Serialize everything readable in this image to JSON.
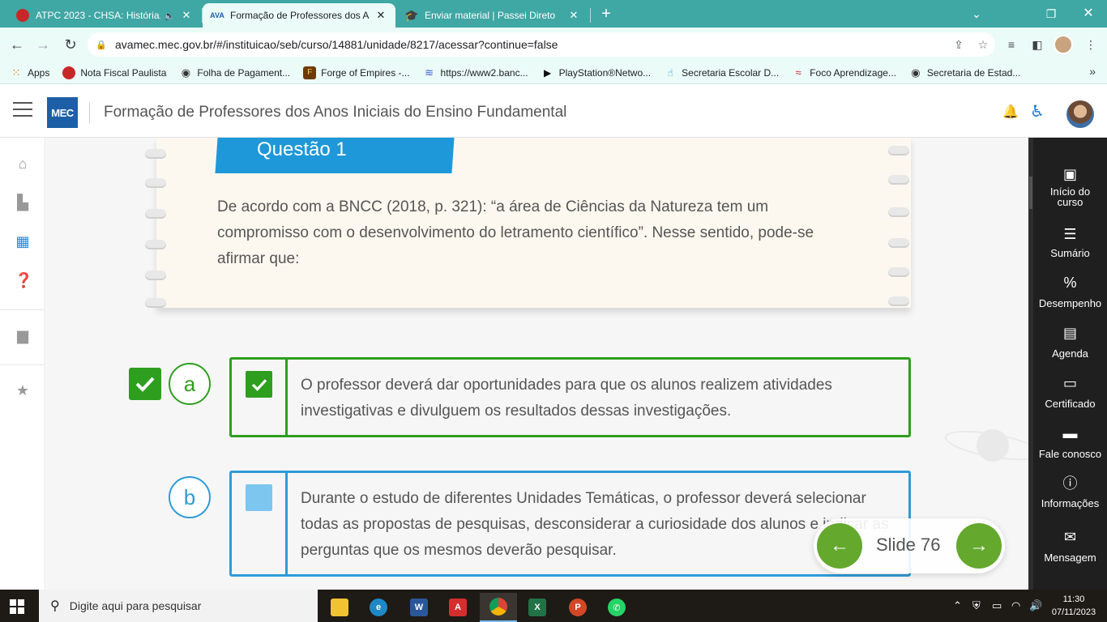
{
  "browser": {
    "tabs": [
      {
        "title": "ATPC 2023 - CHSA: História,",
        "favicon": "audio-tab-favicon",
        "active": false
      },
      {
        "title": "Formação de Professores dos An",
        "favicon": "ava-mec-favicon",
        "active": true
      },
      {
        "title": "Enviar material | Passei Direto",
        "favicon": "passei-direto-favicon",
        "active": false
      }
    ],
    "url": "avamec.mec.gov.br/#/instituicao/seb/curso/14881/unidade/8217/acessar?continue=false",
    "bookmarks": [
      {
        "label": "Apps",
        "icon": "apps-grid-icon",
        "color": "#e8710a"
      },
      {
        "label": "Nota Fiscal Paulista",
        "icon": "nfp-icon",
        "color": "#c62828"
      },
      {
        "label": "Folha de Pagament...",
        "icon": "globe-icon",
        "color": "#333333"
      },
      {
        "label": "Forge of Empires -...",
        "icon": "foe-icon",
        "color": "#6d3b00"
      },
      {
        "label": "https://www2.banc...",
        "icon": "bank-icon",
        "color": "#3b5bdb"
      },
      {
        "label": "PlayStation®Netwo...",
        "icon": "playstation-icon",
        "color": "#111111"
      },
      {
        "label": "Secretaria Escolar D...",
        "icon": "mouse-icon",
        "color": "#1e88e5"
      },
      {
        "label": "Foco Aprendizage...",
        "icon": "foco-icon",
        "color": "#c62828"
      },
      {
        "label": "Secretaria de Estad...",
        "icon": "globe-icon",
        "color": "#333333"
      }
    ]
  },
  "app": {
    "logo": "MEC",
    "title": "Formação de Professores dos Anos Iniciais do Ensino Fundamental"
  },
  "question": {
    "label": "Questão 1",
    "text": "De acordo com a BNCC (2018, p. 321):  “a área de Ciências da Natureza tem um compromisso com o desenvolvimento do letramento científico”. Nesse sentido, pode-se afirmar que:"
  },
  "options": [
    {
      "letter": "a",
      "checked": true,
      "text": "O professor deverá dar oportunidades para que os alunos realizem atividades investigativas e divulguem os resultados dessas investigações.",
      "color": "#2e9e1f"
    },
    {
      "letter": "b",
      "checked": false,
      "text": "Durante o estudo de diferentes Unidades Temáticas, o professor deverá selecionar todas as propostas de pesquisas, desconsiderar a curiosidade dos alunos e indicar as perguntas que os mesmos deverão pesquisar.",
      "color": "#2f9bd7"
    }
  ],
  "slide_nav": {
    "label": "Slide 76"
  },
  "right_panel": [
    {
      "label": "Início do curso",
      "icon": "book-icon"
    },
    {
      "label": "Sumário",
      "icon": "list-icon"
    },
    {
      "label": "Desempenho",
      "icon": "percent-icon"
    },
    {
      "label": "Agenda",
      "icon": "calendar-icon"
    },
    {
      "label": "Certificado",
      "icon": "certificate-icon"
    },
    {
      "label": "Fale conosco",
      "icon": "contact-card-icon"
    },
    {
      "label": "Informações",
      "icon": "info-icon"
    },
    {
      "label": "Mensagem",
      "icon": "mail-icon"
    }
  ],
  "taskbar": {
    "search_placeholder": "Digite aqui para pesquisar",
    "time": "11:30",
    "date": "07/11/2023"
  },
  "colors": {
    "accent_blue": "#1e98d8",
    "correct_green": "#2e9e1f",
    "nav_green": "#64a82e",
    "tab_teal": "#3fa7a4"
  }
}
